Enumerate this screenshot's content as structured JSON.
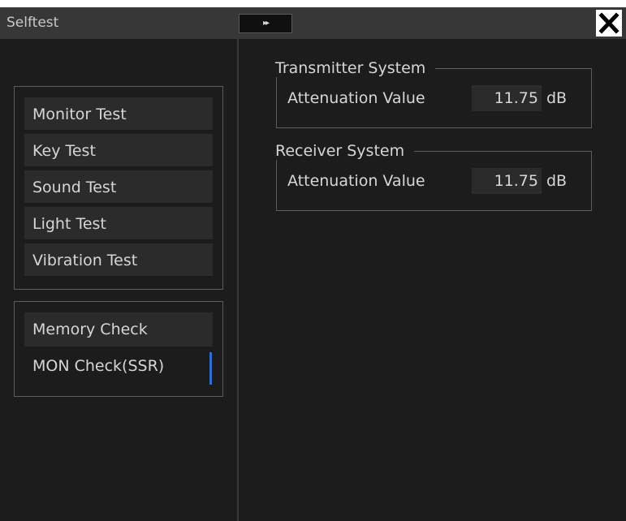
{
  "window": {
    "title": "Selftest",
    "expand_glyph": "▸▸",
    "close_icon": "close-icon"
  },
  "test_menu": [
    {
      "label": "Monitor Test"
    },
    {
      "label": "Key Test"
    },
    {
      "label": "Sound Test"
    },
    {
      "label": "Light Test"
    },
    {
      "label": "Vibration Test"
    }
  ],
  "check_menu": [
    {
      "label": "Memory Check"
    },
    {
      "label": "MON Check(SSR)"
    }
  ],
  "transmitter": {
    "legend": "Transmitter System",
    "label": "Attenuation Value",
    "value": "11.75",
    "unit": "dB"
  },
  "receiver": {
    "legend": "Receiver System",
    "label": "Attenuation Value",
    "value": "11.75",
    "unit": "dB"
  },
  "colors": {
    "background": "#1c1c1c",
    "titlebar": "#373737",
    "accent": "#2f6fd0"
  }
}
